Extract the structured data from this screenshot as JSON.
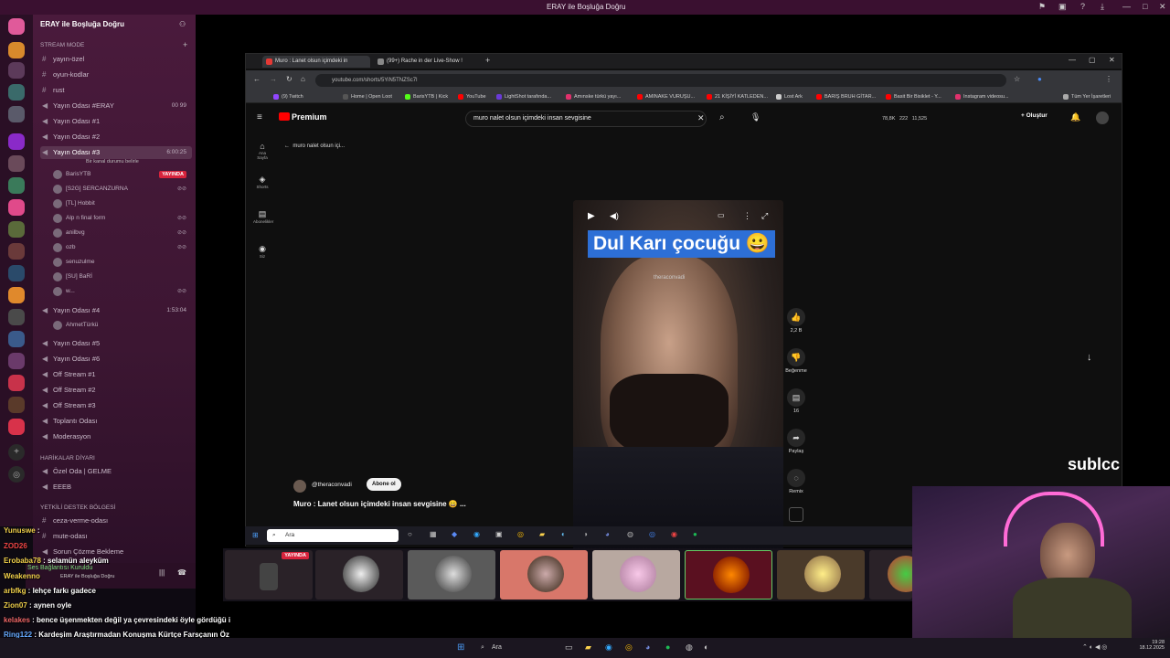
{
  "window": {
    "title": "ERAY ile Boşluğa Doğru"
  },
  "sidebar": {
    "server_name": "ERAY ile Boşluğa Doğru",
    "stream_mode": "Stream Mode",
    "channels": [
      {
        "label": "yayın-özel",
        "type": "text"
      },
      {
        "label": "oyun-kodlar",
        "type": "text"
      },
      {
        "label": "rust",
        "type": "text"
      },
      {
        "label": "Yayın Odası #ERAY",
        "type": "voice",
        "badge": "00 99"
      },
      {
        "label": "Yayın Odası #1",
        "type": "voice"
      },
      {
        "label": "Yayın Odası #2",
        "type": "voice"
      },
      {
        "label": "Yayın Odası #3",
        "type": "voice",
        "time": "6:00:25",
        "sub": "Bir kanal durumu belirle"
      },
      {
        "label": "Yayın Odası #4",
        "type": "voice",
        "time": "1:53:04"
      },
      {
        "label": "Yayın Odası #5",
        "type": "voice"
      },
      {
        "label": "Yayın Odası #6",
        "type": "voice"
      },
      {
        "label": "Off Stream #1",
        "type": "voice"
      },
      {
        "label": "Off Stream #2",
        "type": "voice"
      },
      {
        "label": "Off Stream #3",
        "type": "voice"
      },
      {
        "label": "Toplantı Odası",
        "type": "voice"
      },
      {
        "label": "Moderasyon",
        "type": "voice"
      }
    ],
    "room3_users": [
      "BarisYTB",
      "[S2G] SERCANZURNA",
      "[TL] Hobbit",
      "Alp n final form",
      "anilbvg",
      "ozb",
      "senuzulme",
      "[SU] BaRİ",
      "w..."
    ],
    "live_label": "YAYINDA",
    "room4_users": [
      "AhmetTürkü"
    ],
    "category_fun": "HARİKALAR DİYARI",
    "fun_channels": [
      "Özel Oda | GELME",
      "EEEB"
    ],
    "category_support": "YETKİLİ DESTEK BÖLGESİ",
    "support_channels": [
      "ceza-verme-odası",
      "mute-odası",
      "Sorun Çözme Bekleme"
    ],
    "voice_status": "Ses Bağlantısı Kuruldu",
    "voice_server": "ERAY ile Boşluğa Doğru"
  },
  "browser": {
    "tabs": [
      "Muro : Lanet olsun içimdeki in",
      "(99+) Rache in der Live-Show !"
    ],
    "url": "youtube.com/shorts/5YiN5TNZSc7l",
    "bookmarks": [
      "(9) Twitch",
      "Home | Open Loot",
      "BarisYTB | Kick",
      "YouTube",
      "LightShot tarafında...",
      "Amınske türkü yayı...",
      "AMINAKE VURUŞU...",
      "21 KİŞİYİ KATLEDEN...",
      "Lost Ark",
      "BARIŞ BRUH GİTAR...",
      "Basit Bir Bisiklet - Y...",
      "Instagram videosu...",
      "Tüm Yer İşaretleri"
    ]
  },
  "youtube": {
    "logo": "Premium",
    "search_query": "muro nalet olsun içimdeki insan sevgisine",
    "back_text": "muro nalet olsun içi...",
    "stats": [
      "78,8K",
      "222",
      "11,525"
    ],
    "create_label": "Oluştur",
    "nav": [
      "Ana Sayfa",
      "Shorts",
      "Abonelikler",
      "Siz"
    ],
    "caption": "Dul Karı çocuğu 😀",
    "watermark": "theraconvadi",
    "channel": "@theraconvadi",
    "subscribe": "Abone ol",
    "video_title": "Muro : Lanet olsun içimdeki insan sevgisine 😀 ...",
    "actions": [
      {
        "icon": "like-icon",
        "label": "2,2 B"
      },
      {
        "icon": "dislike-icon",
        "label": "Beğenme"
      },
      {
        "icon": "comment-icon",
        "label": "16"
      },
      {
        "icon": "share-icon",
        "label": "Paylaş"
      },
      {
        "icon": "remix-icon",
        "label": "Remix"
      }
    ]
  },
  "inner_taskbar": {
    "search": "Ara"
  },
  "thumbs": {
    "live": "YAYINDA"
  },
  "chat": [
    {
      "name": "Yunuswe",
      "text": ""
    },
    {
      "name": "ZOD26",
      "text": ""
    },
    {
      "name": "Erobaba78",
      "text": "selamün aleyküm"
    },
    {
      "name": "Weakenno",
      "text": ""
    },
    {
      "name": "arbfkg",
      "text": "lehçe farkı gadece"
    },
    {
      "name": "Zion07",
      "text": "aynen oyle"
    },
    {
      "name": "kelakes",
      "text": "bence üşenmekten değil ya çevresindeki öyle gördüğü i"
    },
    {
      "name": "Ring122",
      "text": "Kardeşim Araştırmadan Konuşma Kürtçe Farsçanın Öz"
    }
  ],
  "overlay": {
    "brand": "sublcc"
  },
  "taskbar": {
    "search": "Ara",
    "time": "19:28",
    "date": "18.12.2025"
  },
  "colors": {
    "accent": "#2d6fd6",
    "live": "#d8233c",
    "sidebar": "#3c1632"
  }
}
